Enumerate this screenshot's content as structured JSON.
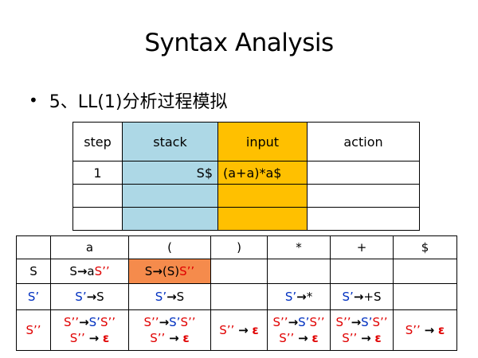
{
  "title": "Syntax Analysis",
  "bullet": {
    "prefix": "5、LL(1)",
    "text": "分析过程模拟"
  },
  "simulation_table": {
    "headers": [
      "step",
      "stack",
      "input",
      "action"
    ],
    "rows": [
      {
        "step": "1",
        "stack": "S$",
        "input": "(a+a)*a$",
        "action": ""
      },
      {
        "step": "",
        "stack": "",
        "input": "",
        "action": ""
      },
      {
        "step": "",
        "stack": "",
        "input": "",
        "action": ""
      }
    ],
    "colors": {
      "stack": "#add8e6",
      "input": "#ffc000"
    }
  },
  "parsing_table": {
    "columns": [
      "",
      "a",
      "(",
      ")",
      "*",
      "+",
      "$"
    ],
    "row_headers": {
      "s": "S",
      "sp": "S’",
      "spp": "S’’"
    },
    "cells": {
      "s_a": {
        "lhs": "S",
        "arrow": "→",
        "rhs1": "a",
        "rhs2": "S’’"
      },
      "s_lp": {
        "lhs": "S",
        "arrow": "→",
        "rhs1": "(S)",
        "rhs2": "S’’"
      },
      "sp_a": {
        "lhs": "S’",
        "arrow": "→",
        "rhs": "S"
      },
      "sp_lp": {
        "lhs": "S’",
        "arrow": "→",
        "rhs": "S"
      },
      "sp_star": {
        "lhs": "S’",
        "arrow": "→",
        "rhs": "*"
      },
      "sp_plus": {
        "lhs": "S’",
        "arrow": "→",
        "rhs": "+S"
      },
      "spp_prod": {
        "lhs": "S’’",
        "arrow": "→",
        "rhs1": "S’",
        "rhs2": "S’’"
      },
      "spp_eps": {
        "lhs": "S’’",
        "arrow": "→",
        "eps": "ε"
      }
    },
    "highlight_color": "#f58b4c"
  }
}
